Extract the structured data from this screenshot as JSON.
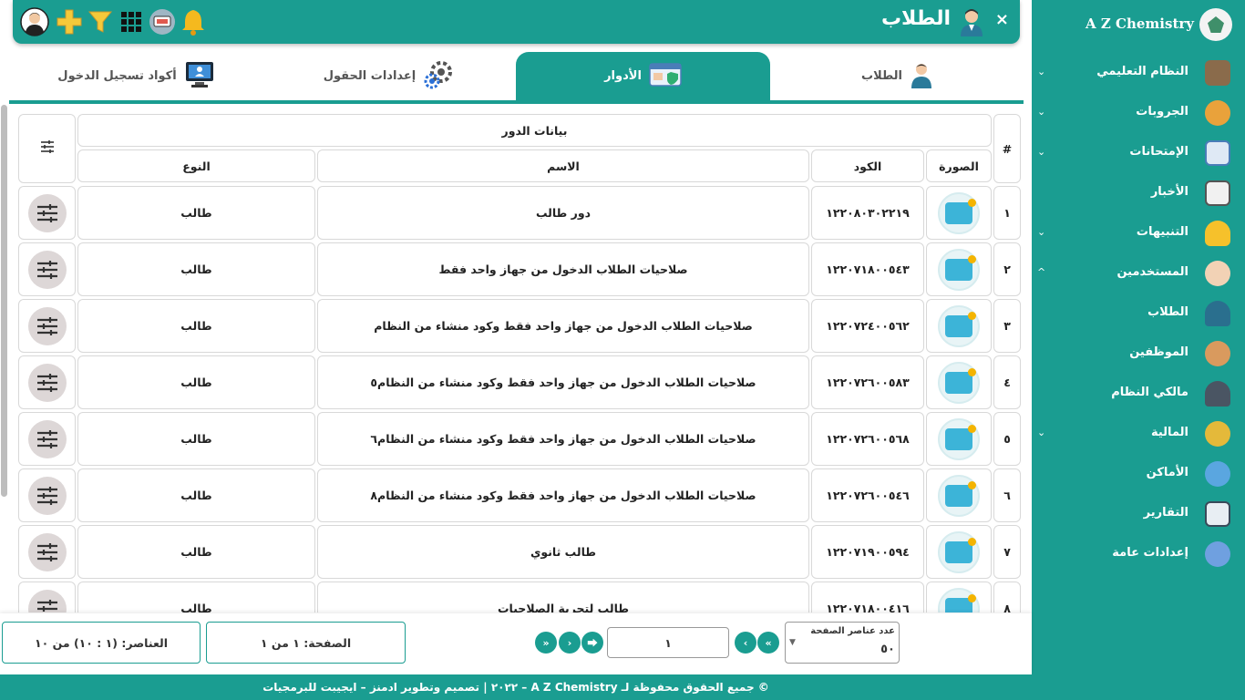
{
  "brand": {
    "title": "A Z Chemistry"
  },
  "sidebar": {
    "items": [
      {
        "label": "النظام التعليمي",
        "icon": "school-icon",
        "chevron": "⌄"
      },
      {
        "label": "الجروبات",
        "icon": "groups-icon",
        "chevron": "⌄"
      },
      {
        "label": "الإمتحانات",
        "icon": "exam-icon",
        "chevron": "⌄"
      },
      {
        "label": "الأخبار",
        "icon": "newspaper-icon",
        "chevron": ""
      },
      {
        "label": "التنبيهات",
        "icon": "bell-icon",
        "chevron": "⌄"
      },
      {
        "label": "المستخدمين",
        "icon": "users-icon",
        "chevron": "^"
      },
      {
        "label": "الطلاب",
        "icon": "student-icon",
        "chevron": ""
      },
      {
        "label": "الموظفين",
        "icon": "employees-icon",
        "chevron": ""
      },
      {
        "label": "مالكي النظام",
        "icon": "owner-icon",
        "chevron": ""
      },
      {
        "label": "المالية",
        "icon": "money-icon",
        "chevron": "⌄"
      },
      {
        "label": "الأماكن",
        "icon": "globe-icon",
        "chevron": ""
      },
      {
        "label": "التقارير",
        "icon": "report-icon",
        "chevron": ""
      },
      {
        "label": "إعدادات عامة",
        "icon": "settings-icon",
        "chevron": ""
      }
    ]
  },
  "header": {
    "title": "الطلاب",
    "close": "×"
  },
  "tabs": [
    {
      "label": "الطلاب"
    },
    {
      "label": "الأدوار"
    },
    {
      "label": "إعدادات الحقول"
    },
    {
      "label": "أكواد تسجيل الدخول"
    }
  ],
  "table": {
    "group_header": "بيانات الدور",
    "columns": {
      "index": "#",
      "image": "الصورة",
      "code": "الكود",
      "name": "الاسم",
      "type": "النوع"
    },
    "rows": [
      {
        "index": "١",
        "code": "١٢٢٠٨٠٣٠٢٢١٩",
        "name": "دور طالب",
        "type": "طالب"
      },
      {
        "index": "٢",
        "code": "١٢٢٠٧١٨٠٠٥٤٣",
        "name": "صلاحيات الطلاب الدخول من جهاز واحد فقط",
        "type": "طالب"
      },
      {
        "index": "٣",
        "code": "١٢٢٠٧٢٤٠٠٥٦٢",
        "name": "صلاحيات الطلاب الدخول من جهاز واحد فقط وكود منشاء من النظام",
        "type": "طالب"
      },
      {
        "index": "٤",
        "code": "١٢٢٠٧٢٦٠٠٥٨٣",
        "name": "صلاحيات الطلاب الدخول من جهاز واحد فقط وكود منشاء من النظام٥",
        "type": "طالب"
      },
      {
        "index": "٥",
        "code": "١٢٢٠٧٢٦٠٠٥٦٨",
        "name": "صلاحيات الطلاب الدخول من جهاز واحد فقط وكود منشاء من النظام٦",
        "type": "طالب"
      },
      {
        "index": "٦",
        "code": "١٢٢٠٧٢٦٠٠٥٤٦",
        "name": "صلاحيات الطلاب الدخول من جهاز واحد فقط وكود منشاء من النظام٨",
        "type": "طالب"
      },
      {
        "index": "٧",
        "code": "١٢٢٠٧١٩٠٠٥٩٤",
        "name": "طالب ثانوي",
        "type": "طالب"
      },
      {
        "index": "٨",
        "code": "١٢٢٠٧١٨٠٠٤١٦",
        "name": "طالب لتجربة الصلاحيات",
        "type": "طالب"
      }
    ]
  },
  "pagination": {
    "page_size_label": "عدد عناصر الصفحة",
    "page_size_value": "٥٠",
    "current_page_input": "١",
    "page_info": "الصفحة: ١ من ١",
    "items_info": "العناصر: (١ : ١٠) من ١٠"
  },
  "footer": {
    "copyright": "© جميع الحقوق محفوظة لـ A Z Chemistry – ٢٠٢٢ | تصميم وتطوير ادمنز – ايجيبت للبرمجيات"
  },
  "colors": {
    "accent": "#1a9d91"
  }
}
